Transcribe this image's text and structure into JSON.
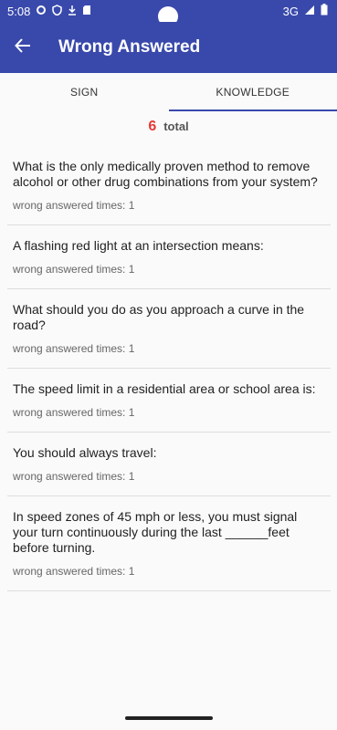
{
  "status": {
    "time": "5:08",
    "network": "3G"
  },
  "appbar": {
    "title": "Wrong Answered"
  },
  "tabs": [
    {
      "label": "SIGN",
      "active": false
    },
    {
      "label": "KNOWLEDGE",
      "active": true
    }
  ],
  "summary": {
    "count": "6",
    "label": "total"
  },
  "questions": [
    {
      "text": "What is the only medically proven method to remove alcohol or other drug combinations from your system?",
      "meta": "wrong answered times: 1"
    },
    {
      "text": "A flashing red light at an intersection means:",
      "meta": "wrong answered times: 1"
    },
    {
      "text": "What should you do as you approach a curve in the road?",
      "meta": "wrong answered times: 1"
    },
    {
      "text": "The speed limit in a residential area or school area is:",
      "meta": "wrong answered times: 1"
    },
    {
      "text": "You should always travel:",
      "meta": "wrong answered times: 1"
    },
    {
      "text": "In speed zones of 45 mph or less, you must signal your turn continuously during the last ______feet before turning.",
      "meta": "wrong answered times: 1"
    }
  ],
  "colors": {
    "primary": "#3949ab",
    "accent_count": "#e53935"
  },
  "icons": {
    "back": "arrow-left-icon"
  }
}
